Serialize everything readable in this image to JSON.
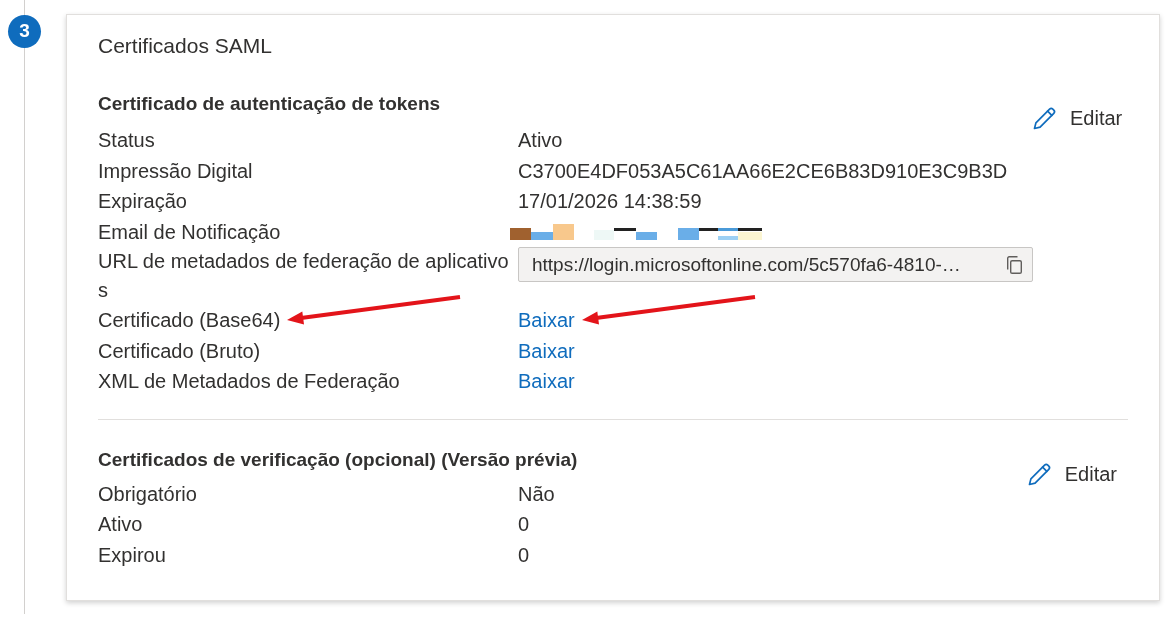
{
  "step_badge": "3",
  "card": {
    "title": "Certificados SAML",
    "sections": [
      {
        "heading": "Certificado de autenticação de tokens",
        "edit_label": "Editar",
        "rows": [
          {
            "kind": "text",
            "label": "Status",
            "value": "Ativo",
            "arrows": false
          },
          {
            "kind": "text",
            "label": "Impressão Digital",
            "value": "C3700E4DF053A5C61AA66E2CE6B83D910E3C9B3D",
            "arrows": false
          },
          {
            "kind": "text",
            "label": "Expiração",
            "value": "17/01/2026 14:38:59",
            "arrows": false
          },
          {
            "kind": "redacted",
            "label": "Email de Notificação",
            "arrows": false
          },
          {
            "kind": "url_field",
            "label": "URL de metadados de federação de aplicativos",
            "value": "https://login.microsoftonline.com/5c570fa6-4810-…",
            "arrows": false
          },
          {
            "kind": "link",
            "label": "Certificado (Base64)",
            "value": "Baixar",
            "arrows": true
          },
          {
            "kind": "link",
            "label": "Certificado (Bruto)",
            "value": "Baixar",
            "arrows": false
          },
          {
            "kind": "link",
            "label": "XML de Metadados de Federação",
            "value": "Baixar",
            "arrows": false
          }
        ]
      },
      {
        "heading": "Certificados de verificação (opcional) (Versão prévia)",
        "edit_label": "Editar",
        "rows": [
          {
            "kind": "text",
            "label": "Obrigatório",
            "value": "Não",
            "arrows": false
          },
          {
            "kind": "text",
            "label": "Ativo",
            "value": "0",
            "arrows": false
          },
          {
            "kind": "text",
            "label": "Expirou",
            "value": "0",
            "arrows": false
          }
        ]
      }
    ]
  }
}
